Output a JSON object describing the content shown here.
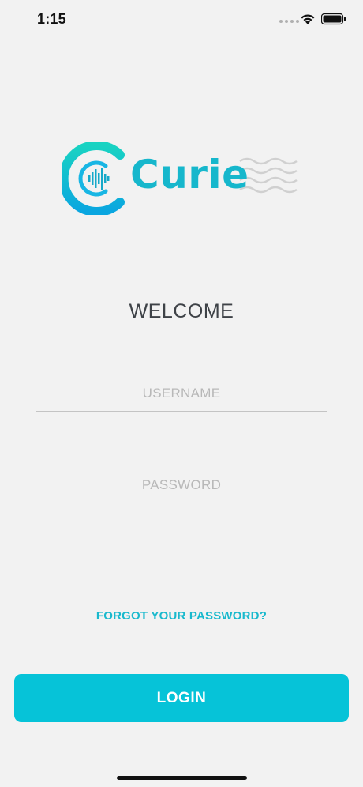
{
  "status_bar": {
    "time": "1:15",
    "icons": [
      "signal-dots-icon",
      "wifi-icon",
      "battery-icon"
    ]
  },
  "logo": {
    "text": "Curie",
    "brand_color": "#16b7cc",
    "icon": "curie-logo-icon"
  },
  "welcome": {
    "title": "WELCOME"
  },
  "form": {
    "username_placeholder": "USERNAME",
    "username_value": "",
    "password_placeholder": "PASSWORD",
    "password_value": ""
  },
  "links": {
    "forgot_password": "FORGOT YOUR PASSWORD?"
  },
  "actions": {
    "login_label": "LOGIN",
    "login_color": "#06c3d8"
  }
}
